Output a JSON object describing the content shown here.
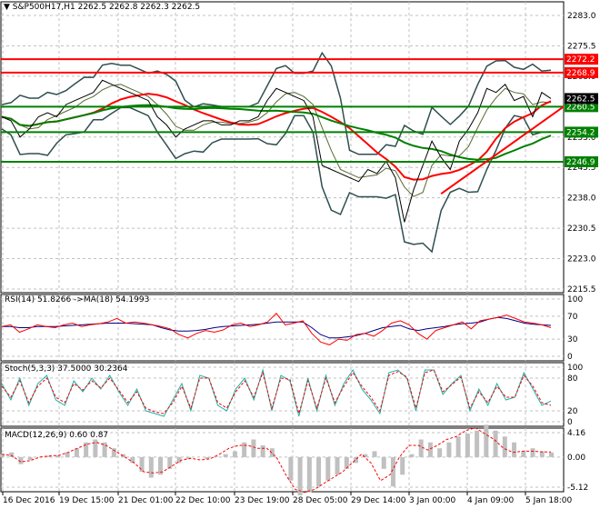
{
  "chart_data": {
    "type": "line",
    "title": "S&P500H17,H1",
    "ohlc": "2262.5 2262.8 2262.3 2262.5",
    "x_ticks": [
      "16 Dec 2016",
      "19 Dec 15:00",
      "21 Dec 01:00",
      "22 Dec 10:00",
      "23 Dec 19:00",
      "28 Dec 05:00",
      "29 Dec 14:00",
      "3 Jan 00:00",
      "4 Jan 09:00",
      "5 Jan 18:00"
    ],
    "price": {
      "y_ticks": [
        2283.0,
        2275.5,
        2268.0,
        2260.5,
        2253.0,
        2245.5,
        2238.0,
        2230.5,
        2223.0,
        2215.5
      ],
      "ylim": [
        2215.5,
        2283.0
      ],
      "close": [
        2258,
        2257,
        2253,
        2255,
        2258,
        2259,
        2258,
        2261,
        2262,
        2263,
        2264,
        2267,
        2266,
        2265,
        2264,
        2263,
        2262,
        2258,
        2256,
        2253,
        2255,
        2256,
        2257,
        2257,
        2256,
        2256,
        2257,
        2257,
        2258,
        2262,
        2265,
        2264,
        2263,
        2262,
        2258,
        2246,
        2245,
        2244,
        2243,
        2242,
        2245,
        2244,
        2247,
        2243,
        2232,
        2240,
        2246,
        2252,
        2248,
        2245,
        2252,
        2255,
        2259,
        2265,
        2264,
        2266,
        2262,
        2263,
        2258,
        2264,
        2262.5
      ],
      "levels": [
        {
          "value": 2272.2,
          "label": "2272.2",
          "color": "#ff0000"
        },
        {
          "value": 2268.9,
          "label": "2268.9",
          "color": "#ff0000"
        },
        {
          "value": 2260.5,
          "label": "2260.5",
          "color": "#008000"
        },
        {
          "value": 2254.2,
          "label": "2254.2",
          "color": "#008000"
        },
        {
          "value": 2246.9,
          "label": "2246.9",
          "color": "#008000"
        }
      ],
      "current": {
        "value": 2262.5,
        "label": "2262.5"
      },
      "trendline": {
        "from": [
          48,
          2239
        ],
        "to": [
          61,
          2260.5
        ],
        "color": "#ff0000"
      }
    },
    "rsi": {
      "label": "RSI(14) 51.8266  ->MA(18) 54.1993",
      "y_ticks": [
        "100",
        "70",
        "30",
        "0"
      ],
      "ylim": [
        0,
        100
      ],
      "values": [
        52,
        55,
        42,
        48,
        55,
        52,
        50,
        55,
        58,
        52,
        55,
        57,
        60,
        66,
        58,
        60,
        58,
        55,
        52,
        48,
        38,
        32,
        40,
        45,
        42,
        46,
        55,
        58,
        52,
        55,
        60,
        75,
        55,
        58,
        62,
        40,
        25,
        20,
        30,
        28,
        38,
        40,
        35,
        45,
        58,
        62,
        55,
        40,
        30,
        45,
        50,
        55,
        60,
        48,
        62,
        65,
        68,
        72,
        66,
        60,
        58,
        55,
        50
      ],
      "ma": [
        52,
        52,
        50,
        50,
        52,
        52,
        52,
        53,
        54,
        55,
        56,
        57,
        58,
        58,
        58,
        57,
        56,
        55,
        50,
        46,
        44,
        44,
        45,
        47,
        50,
        52,
        53,
        54,
        55,
        56,
        58,
        60,
        60,
        60,
        60,
        50,
        38,
        32,
        32,
        34,
        36,
        40,
        45,
        50,
        52,
        54,
        48,
        45,
        48,
        50,
        52,
        55,
        57,
        58,
        60,
        65,
        68,
        66,
        62,
        58,
        56,
        55,
        54
      ]
    },
    "stoch": {
      "label": "Stoch(5,3,3) 37.5000 30.2364",
      "y_ticks": [
        "100",
        "80",
        "20",
        "0"
      ],
      "ylim": [
        0,
        100
      ],
      "main": [
        70,
        40,
        80,
        30,
        70,
        85,
        40,
        30,
        75,
        55,
        80,
        60,
        85,
        55,
        30,
        60,
        20,
        15,
        10,
        40,
        70,
        20,
        85,
        80,
        30,
        20,
        60,
        80,
        40,
        95,
        20,
        85,
        75,
        10,
        80,
        20,
        85,
        30,
        70,
        95,
        60,
        40,
        15,
        90,
        95,
        80,
        20,
        95,
        95,
        50,
        70,
        85,
        20,
        60,
        30,
        70,
        40,
        45,
        90,
        60,
        30,
        38
      ],
      "signal": [
        65,
        45,
        75,
        35,
        65,
        80,
        45,
        35,
        70,
        58,
        75,
        62,
        80,
        58,
        35,
        55,
        25,
        18,
        15,
        35,
        65,
        25,
        80,
        80,
        35,
        25,
        55,
        75,
        45,
        90,
        25,
        80,
        78,
        15,
        75,
        25,
        80,
        35,
        65,
        90,
        65,
        45,
        20,
        85,
        92,
        82,
        25,
        90,
        95,
        55,
        68,
        82,
        25,
        55,
        35,
        65,
        45,
        45,
        85,
        65,
        35,
        30
      ]
    },
    "macd": {
      "label": "MACD(12,26,9) 0.60 0.87",
      "y_ticks": [
        "4.16",
        "0.00",
        "-5.12"
      ],
      "ylim": [
        -5.12,
        4.16
      ],
      "hist": [
        0.5,
        0.8,
        -1.2,
        -0.5,
        0,
        0.2,
        0.3,
        0.8,
        1.5,
        2.5,
        3,
        2.5,
        1.5,
        0.5,
        -1,
        -2.5,
        -3.5,
        -3,
        -2,
        -1,
        -0.3,
        0,
        -0.3,
        0.1,
        0.5,
        1,
        2.5,
        3,
        2,
        1.5,
        0,
        -4,
        -6.5,
        -6,
        -5,
        -4,
        -3,
        -2,
        -1,
        0.5,
        1,
        -2,
        -5,
        -3,
        0.5,
        3,
        2.5,
        1.5,
        2.5,
        3.5,
        4,
        4.5,
        5.5,
        4.5,
        3.5,
        2.5,
        1,
        1.5,
        1,
        0.8
      ],
      "signal": [
        0.5,
        0.3,
        -0.8,
        -0.6,
        0,
        0.2,
        0.3,
        0.8,
        1.5,
        2.2,
        2.5,
        2,
        1,
        0,
        -1,
        -2.5,
        -2.7,
        -2.5,
        -1.5,
        -0.5,
        -0.2,
        -0.5,
        -0.3,
        0.5,
        1.5,
        2,
        2,
        1.5,
        1.5,
        0,
        -3,
        -5.5,
        -6,
        -5.5,
        -4.5,
        -3.5,
        -2.5,
        -1,
        0.5,
        -1,
        -4,
        -3,
        0,
        2,
        2,
        1.2,
        2,
        3,
        3.5,
        4.5,
        5,
        4,
        3,
        1.5,
        0.8,
        1,
        1,
        0.9,
        0.87
      ]
    },
    "colors": {
      "price": "#000000",
      "rsi": "#ff0000",
      "rsi_ma": "#000080",
      "stoch_main": "#20b2aa",
      "stoch_signal": "#ff0000",
      "macd_hist": "#c0c0c0",
      "macd_signal": "#ff0000",
      "ma_fast": "#ff0000",
      "ma_slow": "#008000",
      "bands": "#2f4f4f",
      "current_bg": "#000000"
    }
  }
}
